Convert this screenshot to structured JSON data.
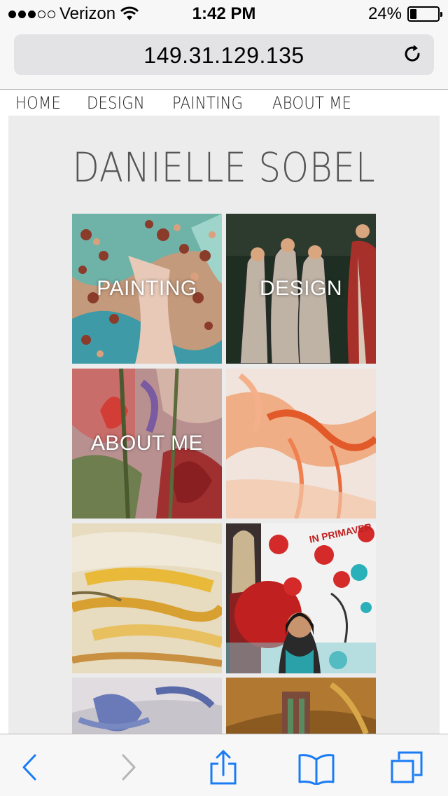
{
  "status_bar": {
    "carrier": "Verizon",
    "time": "1:42 PM",
    "battery_percent": "24%",
    "battery_level": 0.24,
    "signal_bars": 3
  },
  "browser": {
    "url": "149.31.129.135"
  },
  "nav": {
    "items": [
      "HOME",
      "DESIGN",
      "PAINTING",
      "ABOUT ME"
    ]
  },
  "site": {
    "title": "DANIELLE SOBEL"
  },
  "tiles": [
    {
      "label": "PAINTING",
      "kind": "painting-seashells"
    },
    {
      "label": "DESIGN",
      "kind": "design-graces"
    },
    {
      "label": "ABOUT ME",
      "kind": "painting-flowers"
    },
    {
      "label": "",
      "kind": "painting-orange"
    },
    {
      "label": "",
      "kind": "painting-yellow"
    },
    {
      "label": "",
      "kind": "collage-primavera"
    },
    {
      "label": "",
      "kind": "painting-blue"
    },
    {
      "label": "",
      "kind": "painting-gold"
    }
  ],
  "collage_text": "IN PRIMAVER",
  "toolbar": {
    "icons": [
      "back-icon",
      "forward-icon",
      "share-icon",
      "bookmarks-icon",
      "tabs-icon"
    ]
  },
  "colors": {
    "ios_blue": "#1a7cf5",
    "disabled": "#b5b5b5"
  }
}
